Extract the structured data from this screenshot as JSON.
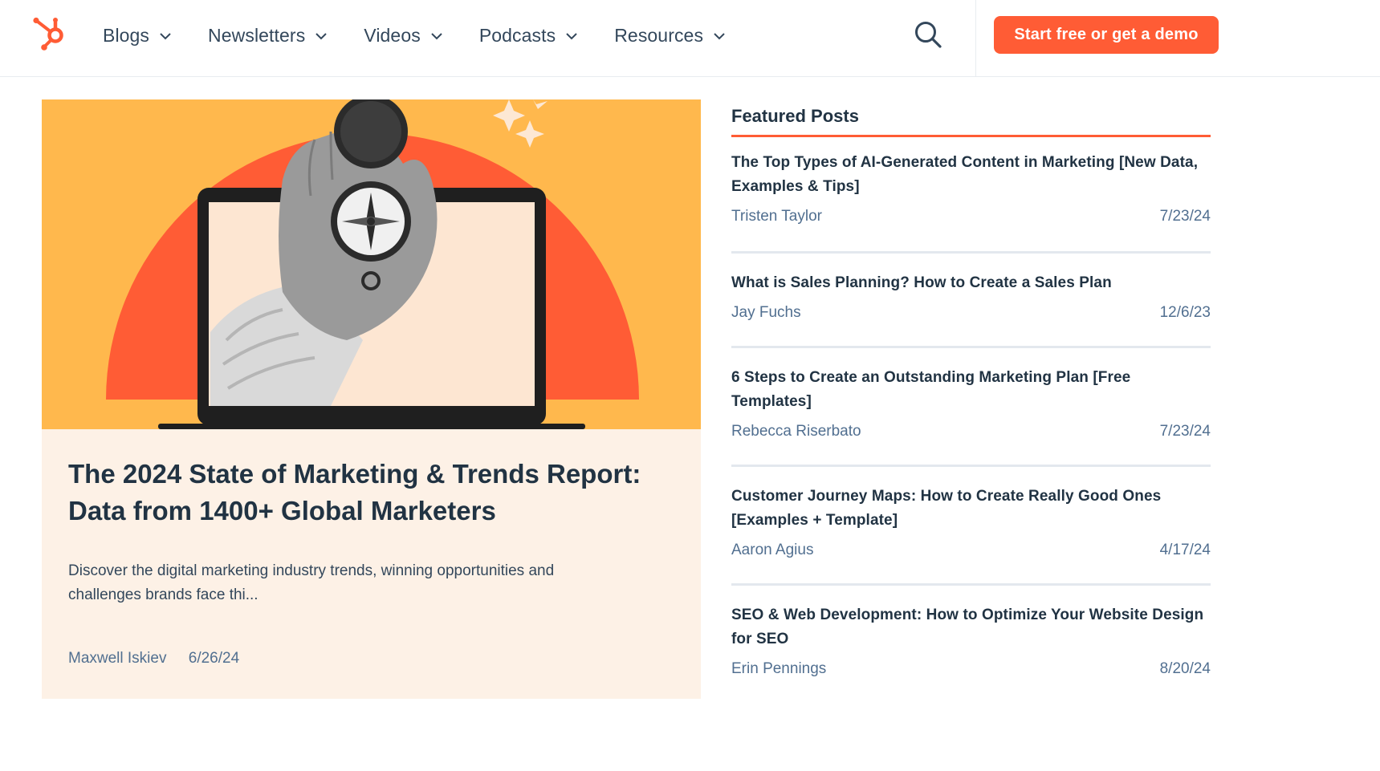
{
  "header": {
    "logo": "hubspot-sprocket-logo",
    "nav": [
      {
        "label": "Blogs"
      },
      {
        "label": "Newsletters"
      },
      {
        "label": "Videos"
      },
      {
        "label": "Podcasts"
      },
      {
        "label": "Resources"
      }
    ],
    "search_icon": "search-icon",
    "cta_label": "Start free or get a demo"
  },
  "hero": {
    "image": "hand-holding-compass-out-of-laptop",
    "title": "The 2024 State of Marketing & Trends Report: Data from 1400+ Global Marketers",
    "description": "Discover the digital marketing industry trends, winning opportunities and challenges brands face thi...",
    "author": "Maxwell Iskiev",
    "date": "6/26/24"
  },
  "featured": {
    "heading": "Featured Posts",
    "posts": [
      {
        "title": "The Top Types of AI-Generated Content in Marketing [New Data, Examples & Tips]",
        "author": "Tristen Taylor",
        "date": "7/23/24"
      },
      {
        "title": "What is Sales Planning? How to Create a Sales Plan",
        "author": "Jay Fuchs",
        "date": "12/6/23"
      },
      {
        "title": "6 Steps to Create an Outstanding Marketing Plan [Free Templates]",
        "author": "Rebecca Riserbato",
        "date": "7/23/24"
      },
      {
        "title": "Customer Journey Maps: How to Create Really Good Ones [Examples + Template]",
        "author": "Aaron Agius",
        "date": "4/17/24"
      },
      {
        "title": "SEO & Web Development: How to Optimize Your Website Design for SEO",
        "author": "Erin Pennings",
        "date": "8/20/24"
      }
    ]
  },
  "colors": {
    "accent": "#ff5c35",
    "text": "#213343",
    "muted": "#516f90",
    "hero_bg": "#fdf1e6"
  }
}
